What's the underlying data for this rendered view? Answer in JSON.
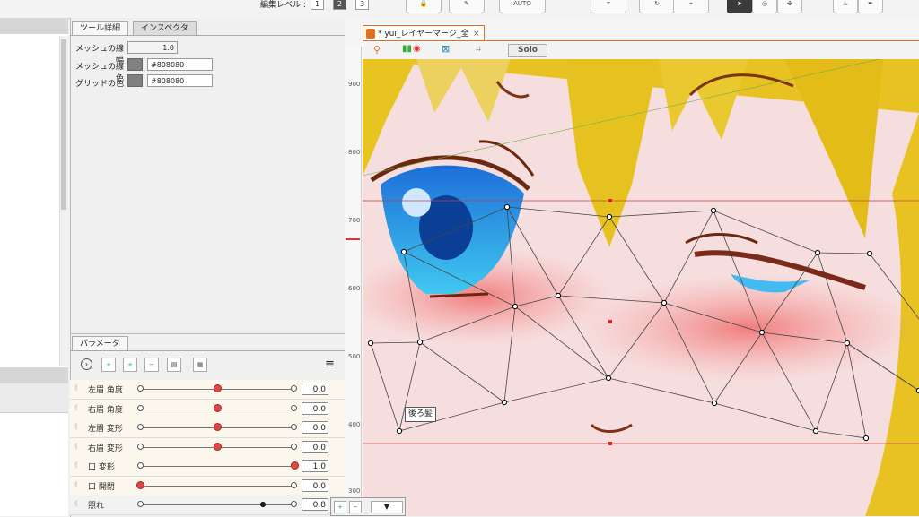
{
  "toolbar": {
    "edit_level_label": "編集レベル :",
    "levels": [
      "1",
      "2",
      "3"
    ],
    "selected_level": "2",
    "auto_label": "AUTO"
  },
  "tool_panel": {
    "tabs": [
      "ツール詳細",
      "インスペクタ"
    ],
    "active_tab": "ツール詳細",
    "mesh_line_width_label": "メッシュの線幅",
    "mesh_line_width_value": "1.0",
    "mesh_line_color_label": "メッシュの線色",
    "mesh_line_color_value": "#808080",
    "grid_color_label": "グリッドの色",
    "grid_color_value": "#808080"
  },
  "param_panel": {
    "title": "パラメータ",
    "params": [
      {
        "name": "左眉 角度",
        "value": "0.0",
        "knob": 0.5
      },
      {
        "name": "右眉 角度",
        "value": "0.0",
        "knob": 0.5
      },
      {
        "name": "左眉 変形",
        "value": "0.0",
        "knob": 0.5
      },
      {
        "name": "右眉 変形",
        "value": "0.0",
        "knob": 0.5
      },
      {
        "name": "口 変形",
        "value": "1.0",
        "knob": 1.0
      },
      {
        "name": "口 開閉",
        "value": "0.0",
        "knob": 0.0
      },
      {
        "name": "照れ",
        "value": "0.8",
        "knob": 0.8
      }
    ]
  },
  "canvas": {
    "doc_tab_title": "* yui_レイヤーマージ_全",
    "close_glyph": "×",
    "solo_label": "Solo",
    "ruler_labels": [
      "900",
      "800",
      "700",
      "600",
      "500",
      "400",
      "300"
    ],
    "tooltip": "後ろ髪"
  },
  "colors": {
    "accent": "#e07020",
    "knob": "#e04848",
    "mesh_color": "#808080"
  }
}
